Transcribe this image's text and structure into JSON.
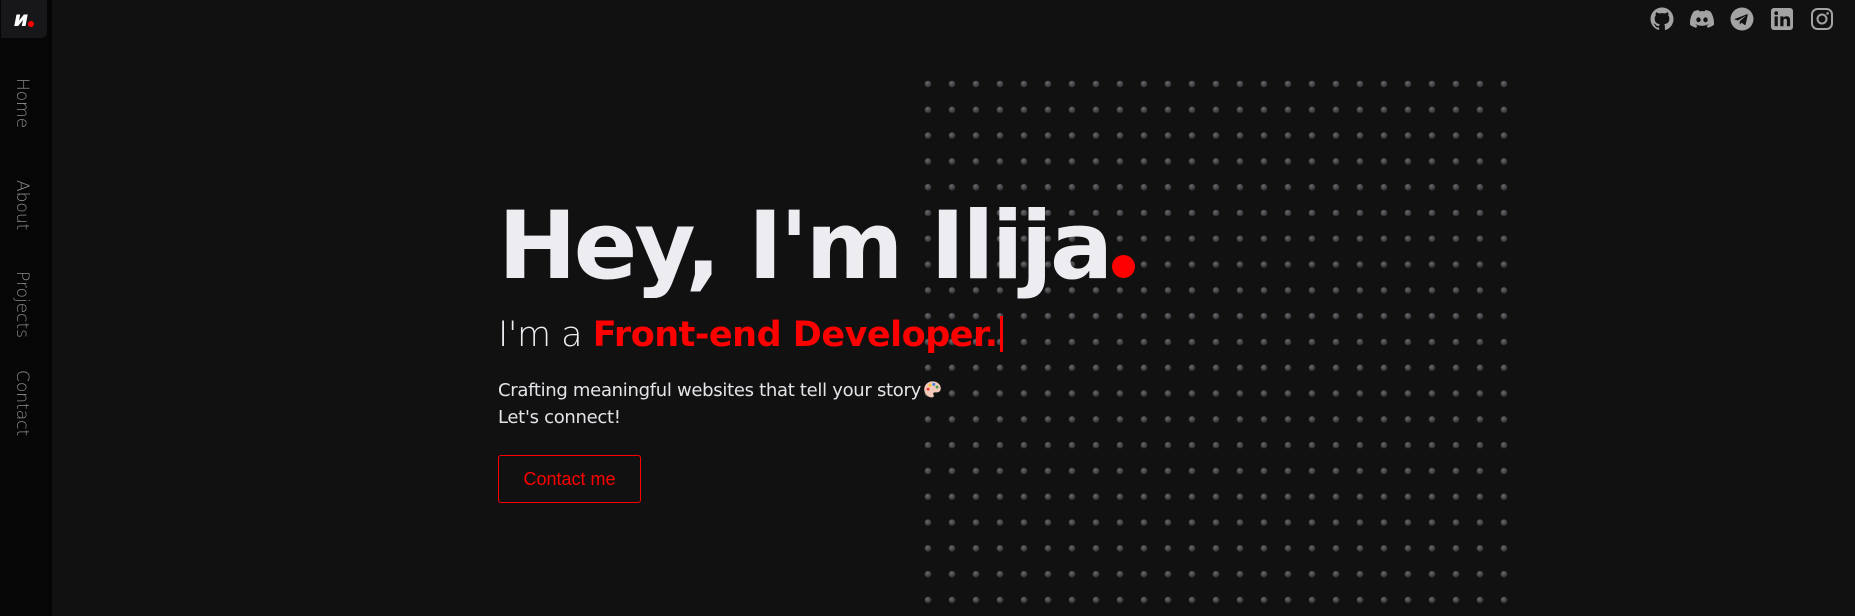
{
  "colors": {
    "accent": "#ff0000",
    "background": "#111112",
    "sidebar": "#060606",
    "text": "#ececf1",
    "muted": "#8d8d8d",
    "icon": "#a3a3a3"
  },
  "logo": {
    "text": "и",
    "icon": "logo-mark"
  },
  "nav": {
    "items": [
      {
        "label": "Home"
      },
      {
        "label": "About"
      },
      {
        "label": "Projects"
      },
      {
        "label": "Contact"
      }
    ]
  },
  "socials": [
    {
      "icon": "github-icon"
    },
    {
      "icon": "discord-icon"
    },
    {
      "icon": "telegram-icon"
    },
    {
      "icon": "linkedin-icon"
    },
    {
      "icon": "instagram-icon"
    }
  ],
  "hero": {
    "title": "Hey, I'm Ilija",
    "subtitle_prefix": "I'm a",
    "subtitle_role": "Front-end Developer.",
    "tagline_line1": "Crafting meaningful websites that tell your story",
    "tagline_line2": "Let's connect!",
    "tagline_icon": "artist-palette-icon",
    "cta_label": "Contact me"
  }
}
